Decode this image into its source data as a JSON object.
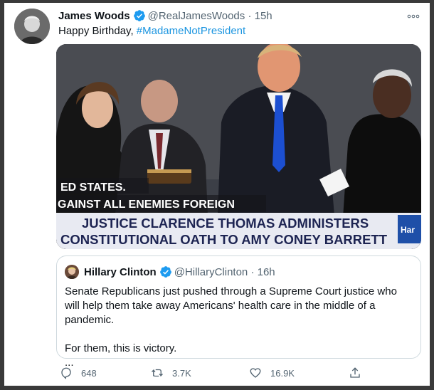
{
  "tweet": {
    "author_name": "James Woods",
    "author_handle": "@RealJamesWoods",
    "separator": "·",
    "time": "15h",
    "text": "Happy Birthday, ",
    "hashtag": "#MadameNotPresident"
  },
  "media": {
    "chyron_partial_1": "ED STATES.",
    "chyron_partial_2": "GAINST ALL ENEMIES FOREIGN",
    "headline_line1": "JUSTICE CLARENCE THOMAS ADMINISTERS",
    "headline_line2": "CONSTITUTIONAL OATH TO AMY CONEY BARRETT",
    "network_logo_text": "Har"
  },
  "quote_tweet": {
    "author_name": "Hillary Clinton",
    "author_handle": "@HillaryClinton",
    "separator": "·",
    "time": "16h",
    "text_line1": "Senate Republicans just pushed through a Supreme Court justice who will help them take away Americans' health care in the middle of a pandemic.",
    "text_line2": "For them, this is victory.",
    "text_line3": "..."
  },
  "actions": {
    "reply_count": "648",
    "retweet_count": "3.7K",
    "like_count": "16.9K"
  },
  "colors": {
    "verified": "#1d9bf0",
    "hashtag": "#1b95e0",
    "muted": "#536471",
    "chyron_band": "#e8eaf2"
  },
  "icons": [
    "more-icon",
    "verified-icon",
    "reply-icon",
    "retweet-icon",
    "like-icon",
    "share-icon"
  ]
}
